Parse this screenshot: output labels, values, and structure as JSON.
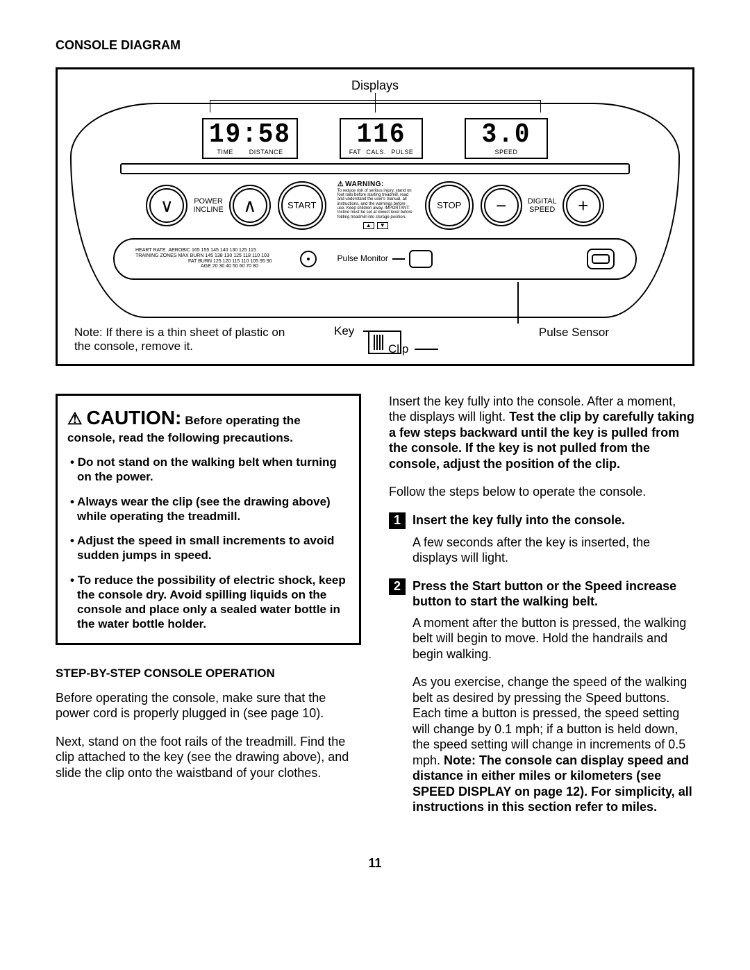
{
  "heading": "CONSOLE DIAGRAM",
  "diagram": {
    "displays_label": "Displays",
    "display1": {
      "value": "19:58",
      "labels": [
        "TIME",
        "DISTANCE"
      ]
    },
    "display2": {
      "value": "116",
      "labels": [
        "FAT",
        "CALS.",
        "PULSE"
      ]
    },
    "display3": {
      "value": "3.0",
      "labels": [
        "SPEED"
      ]
    },
    "incline_label": "POWER\nINCLINE",
    "start_label": "START",
    "stop_label": "STOP",
    "speed_label": "DIGITAL\nSPEED",
    "warning_title": "WARNING:",
    "warning_body": "To reduce risk of serious injury, stand on foot rails before starting treadmill, read and understand the user's manual, all instructions, and the warnings before use. Keep children away. IMPORTANT: Incline must be set at lowest level before folding treadmill into storage position.",
    "hr_table": {
      "row_labels": [
        "HEART RATE",
        "TRAINING ZONES"
      ],
      "lines": [
        {
          "label": "AEROBIC",
          "vals": "165 155 145 140 130 125 115"
        },
        {
          "label": "MAX BURN",
          "vals": "145 138 130 125 118 110 103"
        },
        {
          "label": "FAT BURN",
          "vals": "125 120 115 110 105 95 90"
        },
        {
          "label": "AGE",
          "vals": "20 30 40 50 60 70 80"
        }
      ]
    },
    "pulse_monitor_label": "Pulse Monitor",
    "note": "Note: If there is a thin sheet of plastic on the console, remove it.",
    "key_label": "Key",
    "clip_label": "Clip",
    "pulse_sensor_label": "Pulse Sensor"
  },
  "caution": {
    "title": "CAUTION:",
    "subtitle": "Before operating the console, read the following precautions.",
    "items": [
      "Do not stand on the walking belt when turning on the power.",
      "Always wear the clip (see the drawing above) while operating the treadmill.",
      "Adjust the speed in small increments to avoid sudden jumps in speed.",
      "To reduce the possibility of electric shock, keep the console dry. Avoid spilling liquids on the console and place only a sealed water bottle in the water bottle holder."
    ]
  },
  "step_section_title": "STEP-BY-STEP CONSOLE OPERATION",
  "left_paras": [
    "Before operating the console, make sure that the power cord is properly plugged in (see page 10).",
    "Next, stand on the foot rails of the treadmill. Find the clip attached to the key (see the drawing above), and slide the clip onto the waistband of your clothes."
  ],
  "right_intro_html": "Insert the key fully into the console. After a moment, the displays will light. <b>Test the clip by carefully taking a few steps backward until the key is pulled from the console. If the key is not pulled from the console, adjust the position of the clip.</b>",
  "right_follow": "Follow the steps below to operate the console.",
  "steps": [
    {
      "n": "1",
      "title": "Insert the key fully into the console.",
      "body": "A few seconds after the key is inserted, the displays will light."
    },
    {
      "n": "2",
      "title": "Press the Start button or the Speed increase button to start the walking belt.",
      "body1": "A moment after the button is pressed, the walking belt will begin to move. Hold the handrails and begin walking.",
      "body2_html": "As you exercise, change the speed of the walking belt as desired by pressing the Speed buttons. Each time a button is pressed, the speed setting will change by 0.1 mph; if a button is held down, the speed setting will change in increments of 0.5 mph. <b>Note: The console can display speed and distance in either miles or kilometers (see SPEED DISPLAY on page 12). For simplicity, all instructions in this section refer to miles.</b>"
    }
  ],
  "page_number": "11"
}
